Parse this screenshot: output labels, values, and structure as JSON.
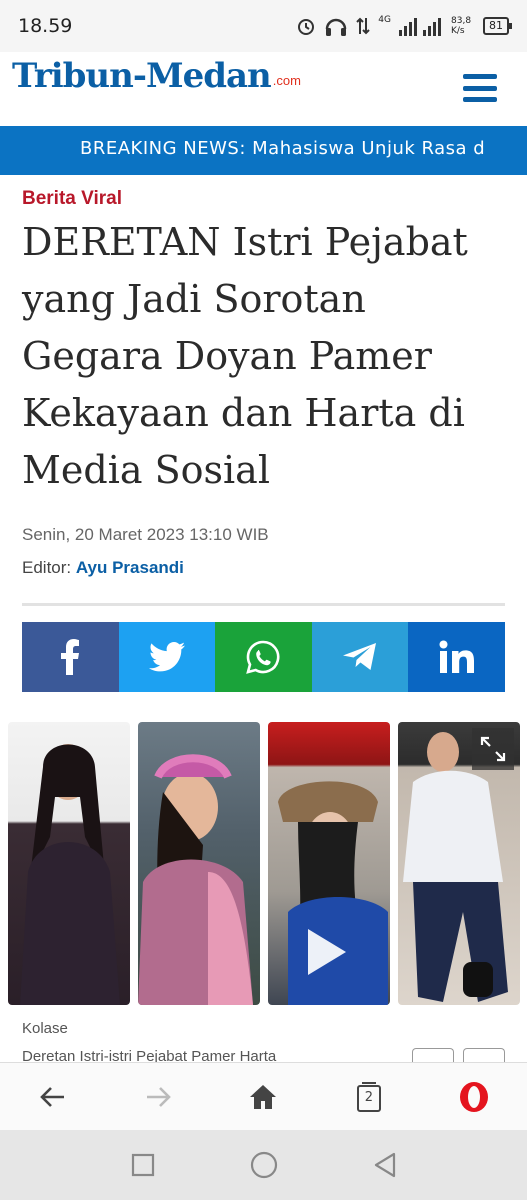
{
  "status_bar": {
    "time": "18.59",
    "network": "4G",
    "speed": "83,8 K/s",
    "battery": "81",
    "icons": [
      "alarm-icon",
      "headphones-icon",
      "data-transfer-icon",
      "signal-icon",
      "battery-icon"
    ]
  },
  "header": {
    "logo_text": "Tribun-Medan",
    "logo_suffix": ".com",
    "menu_icon": "hamburger-menu-icon"
  },
  "breaking_news": {
    "text": "BREAKING NEWS: Mahasiswa Unjuk Rasa d"
  },
  "article": {
    "category": "Berita Viral",
    "title": "DERETAN Istri Pejabat yang Jadi Sorotan Gegara Doyan Pamer Kekayaan dan Harta di Media Sosial",
    "date": "Senin, 20 Maret 2023 13:10 WIB",
    "editor_label": "Editor:",
    "editor_name": "Ayu Prasandi"
  },
  "share_buttons": [
    {
      "name": "facebook",
      "color": "#3b5998",
      "icon": "facebook-icon"
    },
    {
      "name": "twitter",
      "color": "#1da1f2",
      "icon": "twitter-icon"
    },
    {
      "name": "whatsapp",
      "color": "#1aa33a",
      "icon": "whatsapp-icon"
    },
    {
      "name": "telegram",
      "color": "#2b9fd8",
      "icon": "telegram-icon"
    },
    {
      "name": "linkedin",
      "color": "#0a66c2",
      "icon": "linkedin-icon"
    }
  ],
  "photo": {
    "expand_icon": "expand-icon",
    "play_icon": "play-icon"
  },
  "caption": {
    "label": "Kolase",
    "text": "Deretan Istri-istri Pejabat Pamer Harta"
  },
  "browser_bar": {
    "tab_count": "2",
    "icons": [
      "back-arrow-icon",
      "forward-arrow-icon",
      "home-icon",
      "tabs-icon",
      "opera-icon"
    ]
  },
  "system_nav": {
    "icons": [
      "recents-icon",
      "home-circle-icon",
      "back-triangle-icon"
    ]
  }
}
